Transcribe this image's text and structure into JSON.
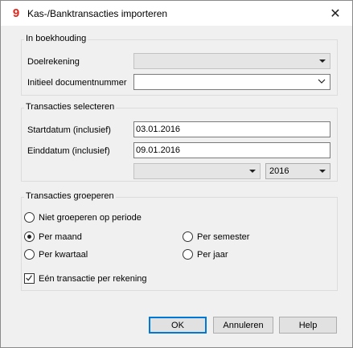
{
  "window": {
    "title": "Kas-/Banktransacties importeren",
    "close_symbol": "✕",
    "app_icon": "banana-9-icon"
  },
  "in_boekhouding": {
    "title": "In boekhouding",
    "doelrekening_label": "Doelrekening",
    "doelrekening_value": "",
    "initieel_label": "Initieel documentnummer",
    "initieel_value": ""
  },
  "transacties_selecteren": {
    "title": "Transacties selecteren",
    "startdatum_label": "Startdatum (inclusief)",
    "startdatum_value": "03.01.2016",
    "einddatum_label": "Einddatum (inclusief)",
    "einddatum_value": "09.01.2016",
    "period_value": "",
    "year_value": "2016"
  },
  "transacties_groeperen": {
    "title": "Transacties groeperen",
    "options": {
      "niet_groeperen": "Niet groeperen op periode",
      "per_maand": "Per maand",
      "per_kwartaal": "Per kwartaal",
      "per_semester": "Per semester",
      "per_jaar": "Per jaar"
    },
    "selected": "per_maand",
    "een_transactie_label": "Eén transactie per rekening",
    "een_transactie_checked": true
  },
  "buttons": {
    "ok": "OK",
    "annuleren": "Annuleren",
    "help": "Help"
  }
}
